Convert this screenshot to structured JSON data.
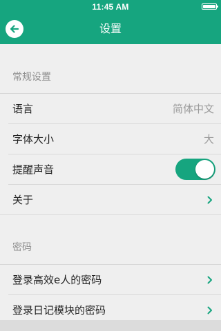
{
  "status_bar": {
    "time": "11:45 AM",
    "battery_level": 1.0
  },
  "navbar": {
    "title": "设置",
    "back_icon": "arrow-left-icon"
  },
  "sections": [
    {
      "title": "常规设置",
      "rows": [
        {
          "label": "语言",
          "value": "简体中文"
        },
        {
          "label": "字体大小",
          "value": "大"
        },
        {
          "label": "提醒声音",
          "toggle_on": true
        },
        {
          "label": "关于",
          "icon": "chevron-right-icon"
        }
      ]
    },
    {
      "title": "密码",
      "rows": [
        {
          "label": "登录高效e人的密码",
          "icon": "chevron-right-icon"
        },
        {
          "label": "登录日记模块的密码",
          "icon": "chevron-right-icon"
        }
      ]
    }
  ],
  "colors": {
    "accent": "#16a57f",
    "background": "#efefef",
    "secondary_text": "#9a9a9a",
    "chevron": "#16a57f"
  }
}
